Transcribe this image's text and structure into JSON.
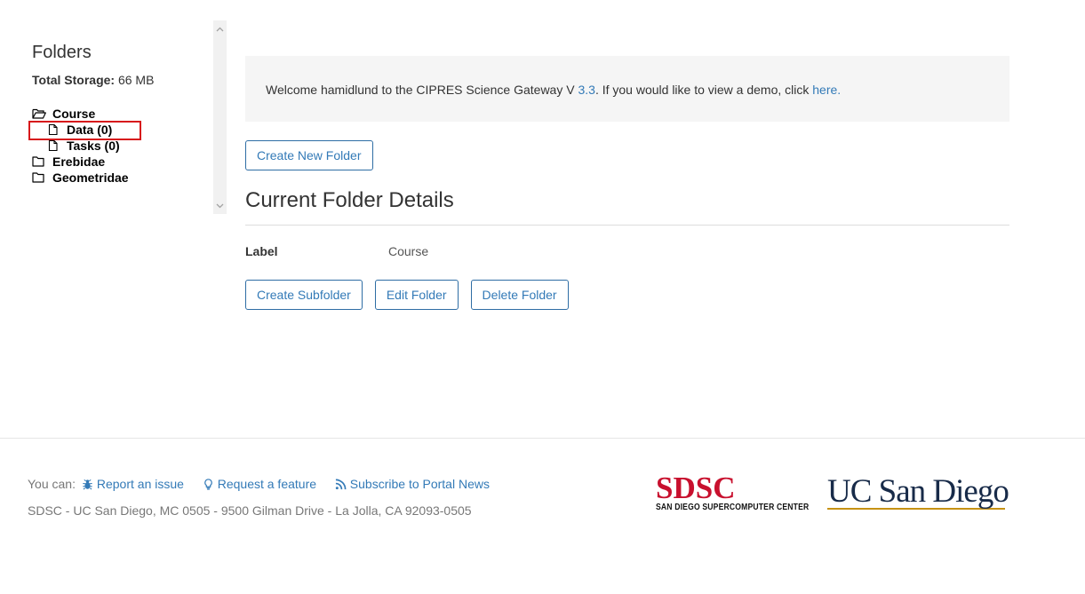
{
  "sidebar": {
    "title": "Folders",
    "storage_label": "Total Storage:",
    "storage_value": "66 MB",
    "tree": [
      {
        "label": "Course",
        "icon": "folder-open-icon",
        "children": [
          {
            "label": "Data (0)",
            "icon": "file-icon"
          },
          {
            "label": "Tasks (0)",
            "icon": "file-icon"
          }
        ]
      },
      {
        "label": "Erebidae",
        "icon": "folder-icon"
      },
      {
        "label": "Geometridae",
        "icon": "folder-icon"
      }
    ]
  },
  "welcome": {
    "prefix": "Welcome hamidlund to the CIPRES Science Gateway V ",
    "version_link": "3.3",
    "middle": ". If you would like to view a demo, click ",
    "demo_link": "here."
  },
  "buttons": {
    "create_new_folder": "Create New Folder",
    "create_subfolder": "Create Subfolder",
    "edit_folder": "Edit Folder",
    "delete_folder": "Delete Folder"
  },
  "details": {
    "title": "Current Folder Details",
    "label_key": "Label",
    "label_value": "Course"
  },
  "footer": {
    "you_can": "You can:",
    "report": "Report an issue",
    "request": "Request a feature",
    "subscribe": "Subscribe to Portal News",
    "address": "SDSC - UC San Diego, MC 0505 - 9500 Gilman Drive - La Jolla, CA 92093-0505"
  },
  "logos": {
    "sdsc_big": "SDSC",
    "sdsc_small": "SAN DIEGO SUPERCOMPUTER CENTER",
    "ucsd": "UC San Diego"
  },
  "colors": {
    "link": "#337ab7",
    "highlight": "#d7191c",
    "sdsc_red": "#c8102e",
    "ucsd_navy": "#182b49",
    "ucsd_gold": "#c69214"
  }
}
